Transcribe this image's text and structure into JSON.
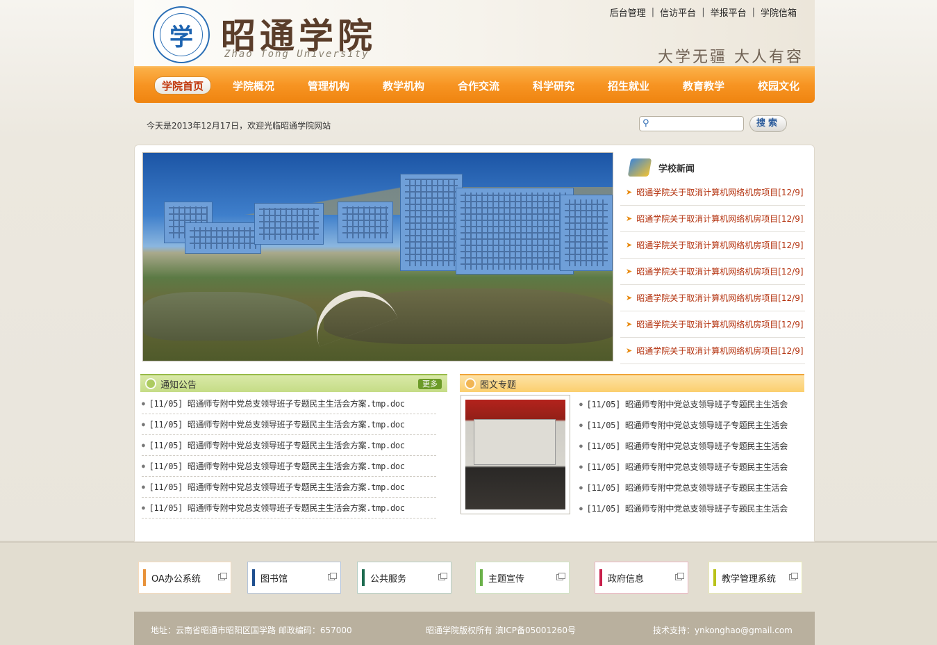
{
  "header": {
    "logo_seal_char": "学",
    "site_title": "昭通学院",
    "site_title_en": "Zhao Tong University",
    "slogan": "大学无疆 大人有容",
    "top_links": [
      "后台管理",
      "信访平台",
      "举报平台",
      "学院信箱"
    ]
  },
  "nav": {
    "items": [
      "学院首页",
      "学院概况",
      "管理机构",
      "教学机构",
      "合作交流",
      "科学研究",
      "招生就业",
      "教育教学",
      "校园文化"
    ],
    "active_index": 0
  },
  "welcome_text": "今天是2013年12月17日，欢迎光临昭通学院网站",
  "search": {
    "placeholder": "",
    "button_label": "搜索"
  },
  "school_news": {
    "title": "学校新闻",
    "items": [
      "昭通学院关于取消计算机网络机房项目[12/9]",
      "昭通学院关于取消计算机网络机房项目[12/9]",
      "昭通学院关于取消计算机网络机房项目[12/9]",
      "昭通学院关于取消计算机网络机房项目[12/9]",
      "昭通学院关于取消计算机网络机房项目[12/9]",
      "昭通学院关于取消计算机网络机房项目[12/9]",
      "昭通学院关于取消计算机网络机房项目[12/9]"
    ]
  },
  "notice": {
    "title": "通知公告",
    "more_label": "更多",
    "items": [
      "[11/05] 昭通师专附中党总支领导班子专题民主生活会方案.tmp.doc",
      "[11/05] 昭通师专附中党总支领导班子专题民主生活会方案.tmp.doc",
      "[11/05] 昭通师专附中党总支领导班子专题民主生活会方案.tmp.doc",
      "[11/05] 昭通师专附中党总支领导班子专题民主生活会方案.tmp.doc",
      "[11/05] 昭通师专附中党总支领导班子专题民主生活会方案.tmp.doc",
      "[11/05] 昭通师专附中党总支领导班子专题民主生活会方案.tmp.doc"
    ]
  },
  "picture_topics": {
    "title": "图文专题",
    "items": [
      "[11/05] 昭通师专附中党总支领导班子专题民主生活会",
      "[11/05] 昭通师专附中党总支领导班子专题民主生活会",
      "[11/05] 昭通师专附中党总支领导班子专题民主生活会",
      "[11/05] 昭通师专附中党总支领导班子专题民主生活会",
      "[11/05] 昭通师专附中党总支领导班子专题民主生活会",
      "[11/05] 昭通师专附中党总支领导班子专题民主生活会"
    ]
  },
  "quick_links": [
    {
      "label": "OA办公系统",
      "color": "#e8923a"
    },
    {
      "label": "图书馆",
      "color": "#1f4f8f"
    },
    {
      "label": "公共服务",
      "color": "#1d6b4f"
    },
    {
      "label": "主题宣传",
      "color": "#6bb14a"
    },
    {
      "label": "政府信息",
      "color": "#c81e4a"
    },
    {
      "label": "教学管理系统",
      "color": "#b9c21a"
    }
  ],
  "footer": {
    "address": "地址：云南省昭通市昭阳区国学路 邮政编码：657000",
    "copyright": "昭通学院版权所有  滇ICP备05001260号",
    "support": "技术支持：ynkonghao@gmail.com"
  }
}
